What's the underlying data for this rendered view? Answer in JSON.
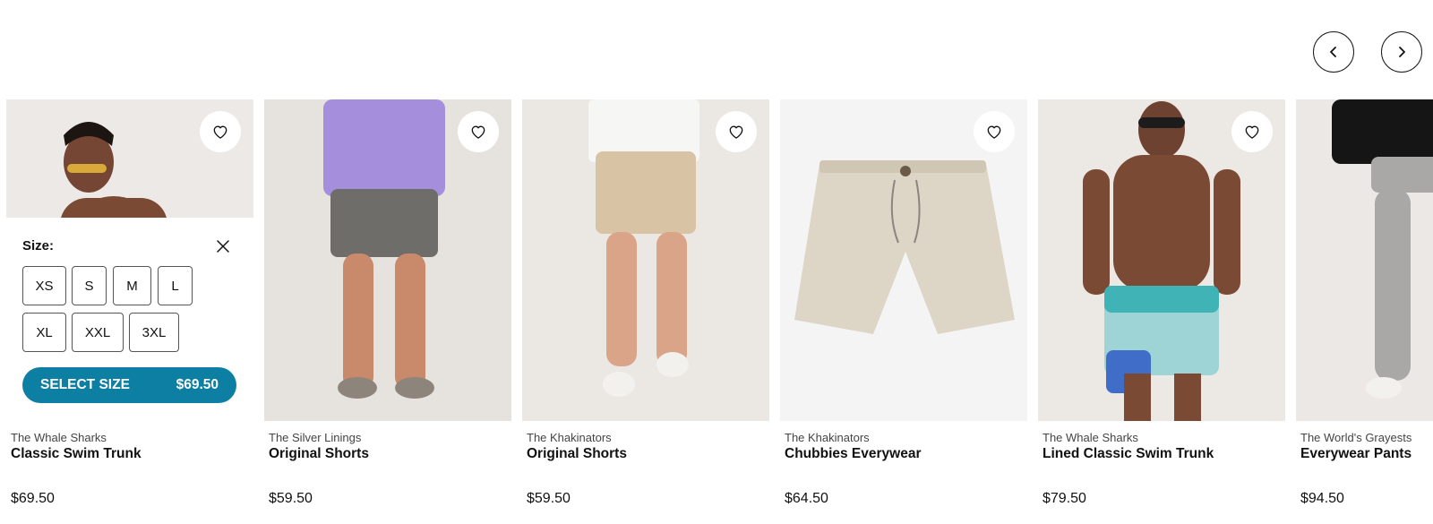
{
  "nav": {
    "prev_icon": "chevron-left-icon",
    "next_icon": "chevron-right-icon"
  },
  "colors": {
    "accent": "#0d7fa3",
    "text": "#111111",
    "muted": "#444444"
  },
  "size_selector": {
    "title": "Size:",
    "close_icon": "close-icon",
    "sizes": [
      "XS",
      "S",
      "M",
      "L",
      "XL",
      "XXL",
      "3XL"
    ],
    "cta_label": "SELECT SIZE",
    "cta_price": "$69.50"
  },
  "products": [
    {
      "collection": "The Whale Sharks",
      "name": "Classic Swim Trunk",
      "price": "$69.50",
      "wishlist_icon": "heart-icon"
    },
    {
      "collection": "The Silver Linings",
      "name": "Original Shorts",
      "price": "$59.50",
      "wishlist_icon": "heart-icon"
    },
    {
      "collection": "The Khakinators",
      "name": "Original Shorts",
      "price": "$59.50",
      "wishlist_icon": "heart-icon"
    },
    {
      "collection": "The Khakinators",
      "name": "Chubbies Everywear",
      "price": "$64.50",
      "wishlist_icon": "heart-icon"
    },
    {
      "collection": "The Whale Sharks",
      "name": "Lined Classic Swim Trunk",
      "price": "$79.50",
      "wishlist_icon": "heart-icon"
    },
    {
      "collection": "The World's Grayests",
      "name": "Everywear Pants",
      "price": "$94.50",
      "wishlist_icon": "heart-icon"
    }
  ]
}
